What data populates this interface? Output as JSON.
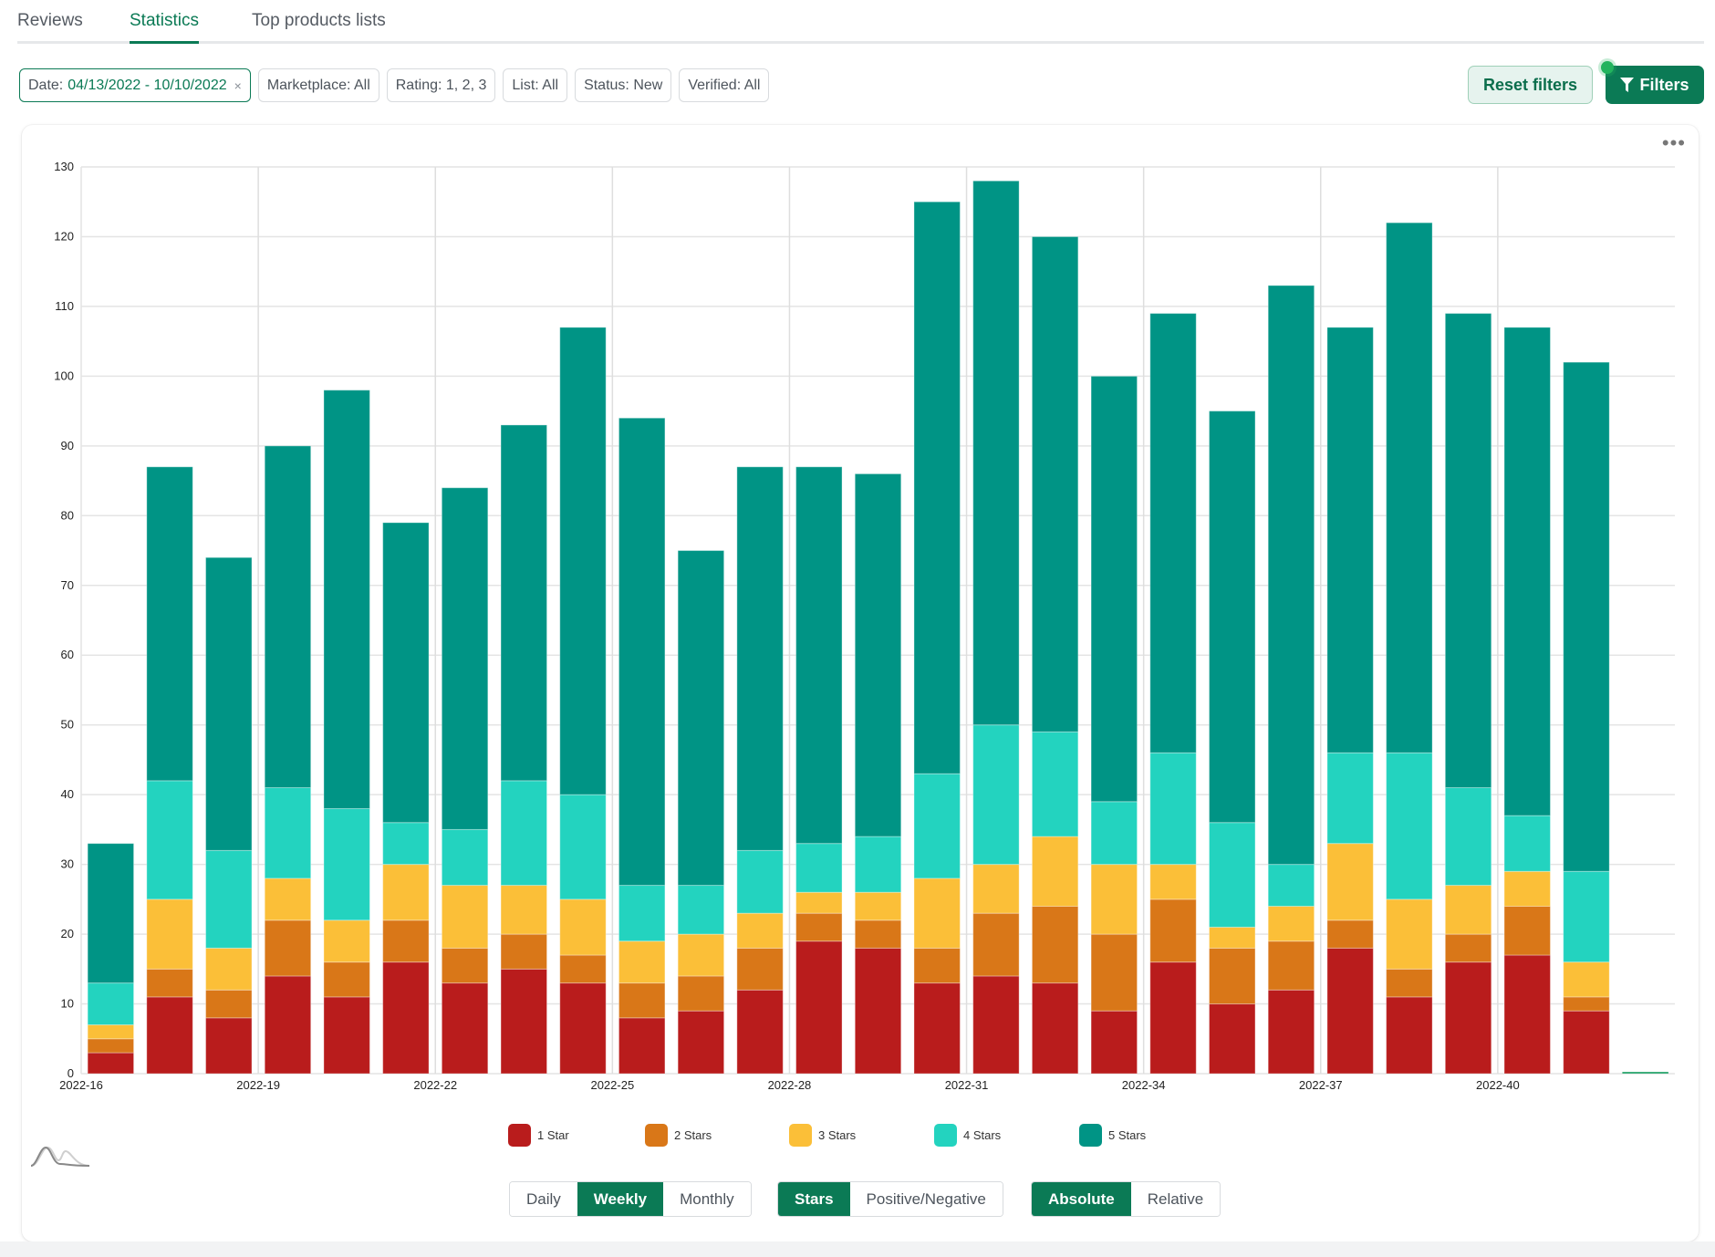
{
  "tabs": [
    {
      "label": "Reviews",
      "active": false
    },
    {
      "label": "Statistics",
      "active": true
    },
    {
      "label": "Top products lists",
      "active": false
    }
  ],
  "filters": {
    "date": {
      "label": "Date:",
      "value": "04/13/2022 - 10/10/2022",
      "clear_icon": "×"
    },
    "chips": [
      {
        "label": "Marketplace: All"
      },
      {
        "label": "Rating: 1, 2, 3"
      },
      {
        "label": "List: All"
      },
      {
        "label": "Status: New"
      },
      {
        "label": "Verified: All"
      }
    ],
    "reset_label": "Reset filters",
    "filters_label": "Filters"
  },
  "card": {
    "more_icon": "•••"
  },
  "controls": {
    "period": {
      "options": [
        "Daily",
        "Weekly",
        "Monthly"
      ],
      "selected": "Weekly"
    },
    "mode": {
      "options": [
        "Stars",
        "Positive/Negative"
      ],
      "selected": "Stars"
    },
    "scale": {
      "options": [
        "Absolute",
        "Relative"
      ],
      "selected": "Absolute"
    }
  },
  "chart_data": {
    "type": "bar",
    "stacked": true,
    "title": "",
    "xlabel": "",
    "ylabel": "",
    "ylim": [
      0,
      130
    ],
    "yticks": [
      0,
      10,
      20,
      30,
      40,
      50,
      60,
      70,
      80,
      90,
      100,
      110,
      120,
      130
    ],
    "grid": true,
    "legend_position": "bottom",
    "categories": [
      "2022-16",
      "2022-17",
      "2022-18",
      "2022-19",
      "2022-20",
      "2022-21",
      "2022-22",
      "2022-23",
      "2022-24",
      "2022-25",
      "2022-26",
      "2022-27",
      "2022-28",
      "2022-29",
      "2022-30",
      "2022-31",
      "2022-32",
      "2022-33",
      "2022-34",
      "2022-35",
      "2022-36",
      "2022-37",
      "2022-38",
      "2022-39",
      "2022-40",
      "2022-41",
      "2022-42"
    ],
    "xtick_labels": [
      "2022-16",
      "2022-19",
      "2022-22",
      "2022-25",
      "2022-28",
      "2022-31",
      "2022-34",
      "2022-37",
      "2022-40"
    ],
    "series": [
      {
        "name": "1 Star",
        "color": "#b91c1c",
        "values": [
          3,
          11,
          8,
          14,
          11,
          16,
          13,
          15,
          13,
          8,
          9,
          12,
          19,
          18,
          13,
          14,
          13,
          9,
          16,
          10,
          12,
          18,
          11,
          16,
          17,
          9,
          0
        ]
      },
      {
        "name": "2 Stars",
        "color": "#d97718",
        "values": [
          2,
          4,
          4,
          8,
          5,
          6,
          5,
          5,
          4,
          5,
          5,
          6,
          4,
          4,
          5,
          9,
          11,
          11,
          9,
          8,
          7,
          4,
          4,
          4,
          7,
          2,
          0
        ]
      },
      {
        "name": "3 Stars",
        "color": "#fbbf38",
        "values": [
          2,
          10,
          6,
          6,
          6,
          8,
          9,
          7,
          8,
          6,
          6,
          5,
          3,
          4,
          10,
          7,
          10,
          10,
          5,
          3,
          5,
          11,
          10,
          7,
          5,
          5,
          0
        ]
      },
      {
        "name": "4 Stars",
        "color": "#23d3bf",
        "values": [
          6,
          17,
          14,
          13,
          16,
          6,
          8,
          15,
          15,
          8,
          7,
          9,
          7,
          8,
          15,
          20,
          15,
          9,
          16,
          15,
          6,
          13,
          21,
          14,
          8,
          13,
          0
        ]
      },
      {
        "name": "5 Stars",
        "color": "#009485",
        "values": [
          20,
          45,
          42,
          49,
          60,
          43,
          49,
          51,
          67,
          67,
          48,
          55,
          54,
          52,
          82,
          78,
          71,
          61,
          63,
          59,
          83,
          61,
          76,
          68,
          70,
          73,
          0
        ]
      }
    ],
    "totals": [
      33,
      87,
      74,
      90,
      98,
      79,
      84,
      93,
      107,
      94,
      75,
      87,
      87,
      86,
      125,
      128,
      120,
      100,
      109,
      95,
      113,
      107,
      122,
      109,
      107,
      102,
      0
    ]
  }
}
